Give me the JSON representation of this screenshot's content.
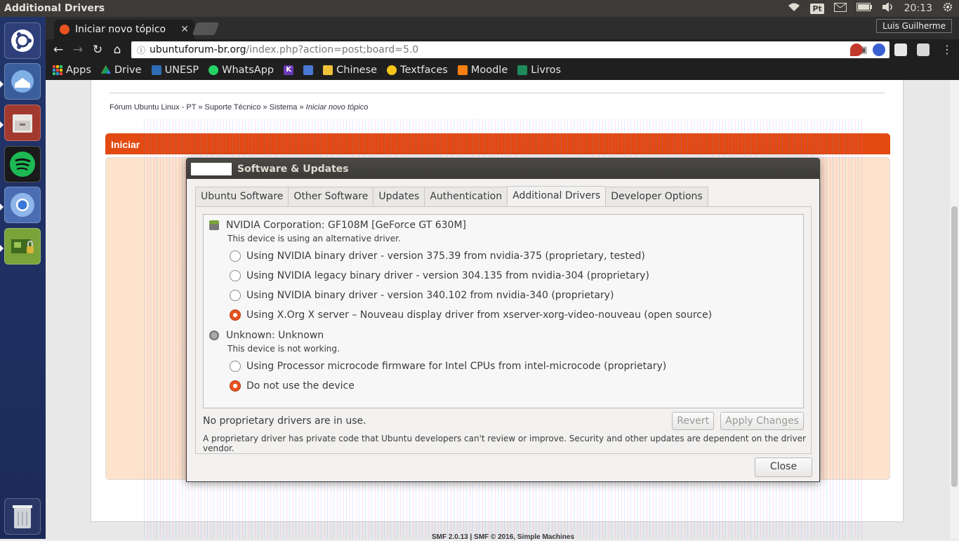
{
  "panel": {
    "app_title": "Additional Drivers",
    "keyboard_layout": "Pt",
    "time": "20:13"
  },
  "browser": {
    "tab_title": "Iniciar novo tópico",
    "profile_name": "Luis Guilherme",
    "url_host": "ubuntuforum-br.org",
    "url_path": "/index.php?action=post;board=5.0",
    "bookmarks": [
      "Apps",
      "Drive",
      "UNESP",
      "WhatsApp",
      "",
      "",
      "Chinese",
      "Textfaces",
      "Moodle",
      "Livros"
    ]
  },
  "page": {
    "breadcrumb": [
      "Fórum Ubuntu Linux - PT",
      "Suporte Técnico",
      "Sistema"
    ],
    "breadcrumb_current": "Iniciar novo tópico",
    "section_header": "Iniciar",
    "footer": "SMF 2.0.13 | SMF © 2016, Simple Machines"
  },
  "dialog": {
    "title": "Software & Updates",
    "tabs": [
      "Ubuntu Software",
      "Other Software",
      "Updates",
      "Authentication",
      "Additional Drivers",
      "Developer Options"
    ],
    "active_tab": "Additional Drivers",
    "devices": [
      {
        "name": "NVIDIA Corporation: GF108M [GeForce GT 630M]",
        "status": "This device is using an alternative driver.",
        "options": [
          {
            "label": "Using NVIDIA binary driver - version 375.39 from nvidia-375 (proprietary, tested)",
            "selected": false
          },
          {
            "label": "Using NVIDIA legacy binary driver - version 304.135 from nvidia-304 (proprietary)",
            "selected": false
          },
          {
            "label": "Using NVIDIA binary driver - version 340.102 from nvidia-340 (proprietary)",
            "selected": false
          },
          {
            "label": "Using X.Org X server – Nouveau display driver from xserver-xorg-video-nouveau (open source)",
            "selected": true
          }
        ]
      },
      {
        "name": "Unknown: Unknown",
        "status": "This device is not working.",
        "options": [
          {
            "label": "Using Processor microcode firmware for Intel CPUs from intel-microcode (proprietary)",
            "selected": false
          },
          {
            "label": "Do not use the device",
            "selected": true
          }
        ]
      }
    ],
    "status_text": "No proprietary drivers are in use.",
    "revert_label": "Revert",
    "apply_label": "Apply Changes",
    "note": "A proprietary driver has private code that Ubuntu developers can't review or improve. Security and other updates are dependent on the driver vendor.",
    "close_label": "Close"
  },
  "colors": {
    "accent": "#e95420",
    "panel": "#3c3b37",
    "launcher": "#1b2a59"
  }
}
